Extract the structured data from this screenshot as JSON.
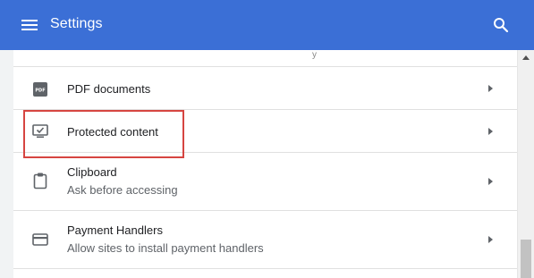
{
  "header": {
    "title": "Settings"
  },
  "top_row": {
    "fragment": "y"
  },
  "rows": [
    {
      "label": "PDF documents",
      "icon": "pdf-icon"
    },
    {
      "label": "Protected content",
      "icon": "protected-content-icon"
    },
    {
      "label": "Clipboard",
      "sublabel": "Ask before accessing",
      "icon": "clipboard-icon"
    },
    {
      "label": "Payment Handlers",
      "sublabel": "Allow sites to install payment handlers",
      "icon": "payment-card-icon"
    }
  ],
  "colors": {
    "header_bg": "#3b6fd6",
    "highlight_border": "#d64541",
    "text_primary": "#202124",
    "text_secondary": "#5f6368"
  }
}
